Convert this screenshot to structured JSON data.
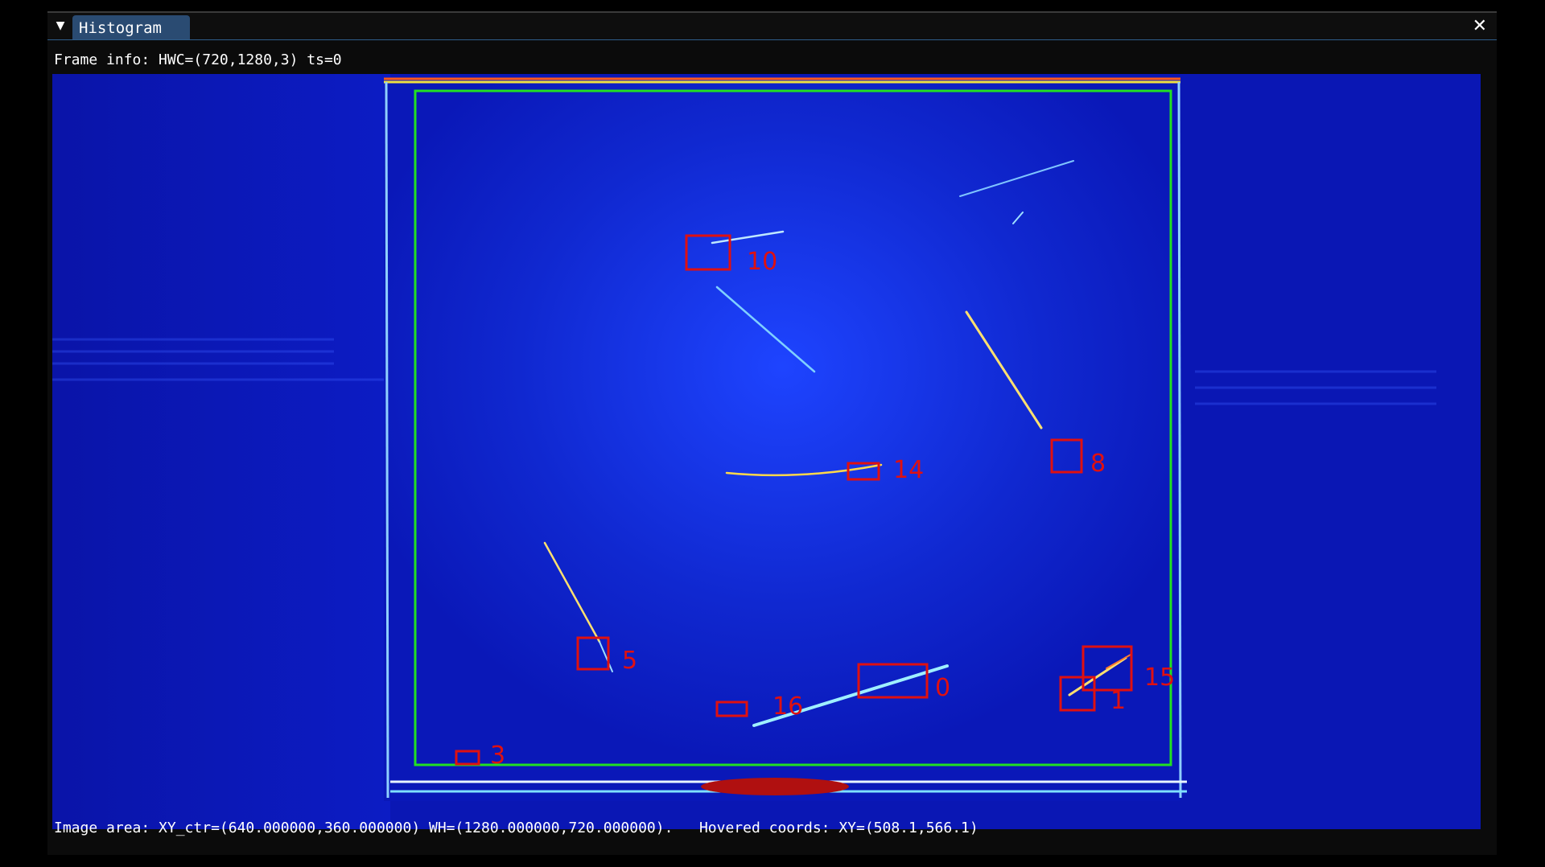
{
  "window": {
    "title": "Histogram",
    "collapse_icon": "triangle-down-icon",
    "close_icon": "close-icon"
  },
  "frame_info": "Frame info: HWC=(720,1280,3) ts=0",
  "status": {
    "image_area": "Image area: XY_ctr=(640.000000,360.000000) WH=(1280.000000,720.000000).",
    "hovered": "Hovered coords: XY=(508.1,566.1)"
  },
  "detections": [
    {
      "label": "10"
    },
    {
      "label": "14"
    },
    {
      "label": "8"
    },
    {
      "label": "5"
    },
    {
      "label": "0"
    },
    {
      "label": "15"
    },
    {
      "label": "1"
    },
    {
      "label": "16"
    },
    {
      "label": "3"
    }
  ],
  "colors": {
    "background": "#0a18b8",
    "roi": "#22e022",
    "box": "#e01010",
    "tab": "#2a4b72"
  }
}
